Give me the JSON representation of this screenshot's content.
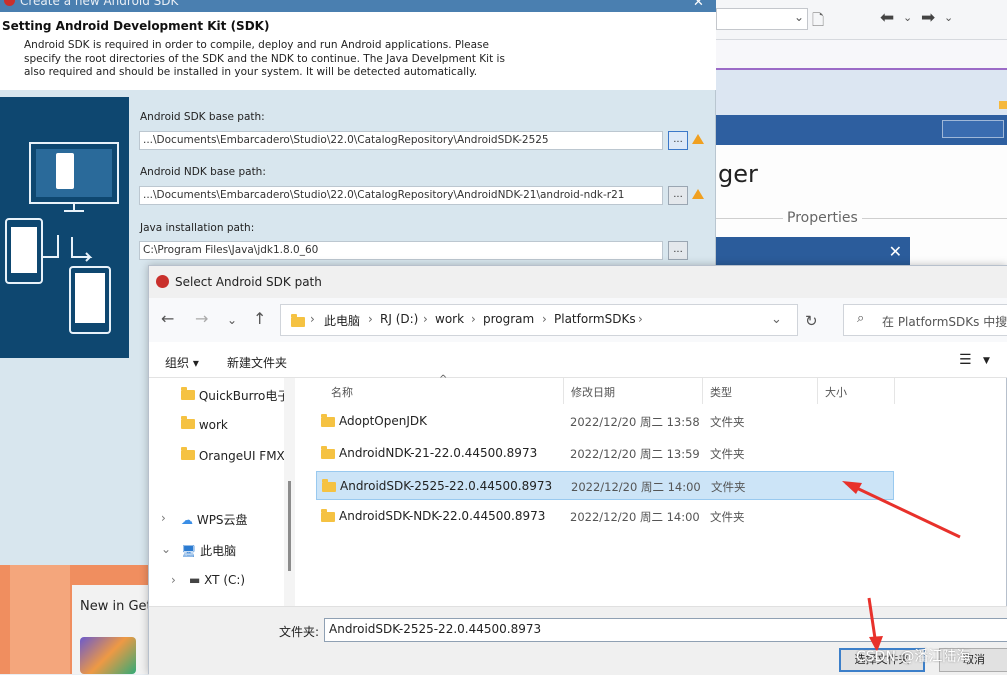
{
  "wizard": {
    "window_title": "Create a new Android SDK",
    "heading": "Setting Android Development Kit (SDK)",
    "description": "Android SDK is required in order to compile, deploy and run Android applications. Please specify the root directories of the SDK and the NDK to continue. The Java Develpment Kit is also required and should be installed in your system. It will be detected automatically.",
    "sdk_label": "Android SDK base path:",
    "sdk_value": "...\\Documents\\Embarcadero\\Studio\\22.0\\CatalogRepository\\AndroidSDK-2525",
    "ndk_label": "Android NDK base path:",
    "ndk_value": "...\\Documents\\Embarcadero\\Studio\\22.0\\CatalogRepository\\AndroidNDK-21\\android-ndk-r21",
    "java_label": "Java installation path:",
    "java_value": "C:\\Program Files\\Java\\jdk1.8.0_60",
    "browse_label": "..."
  },
  "ide": {
    "title_fragment": "ger",
    "properties_label": "Properties",
    "new_in": "New in Get"
  },
  "dialog": {
    "title": "Select Android SDK path",
    "breadcrumb": [
      "此电脑",
      "RJ (D:)",
      "work",
      "program",
      "PlatformSDKs"
    ],
    "search_placeholder": "在 PlatformSDKs 中搜索",
    "organize": "组织 ▾",
    "new_folder": "新建文件夹",
    "sidebar": [
      {
        "label": "QuickBurro电子",
        "type": "folder"
      },
      {
        "label": "work",
        "type": "folder"
      },
      {
        "label": "OrangeUI FMX",
        "type": "folder"
      },
      {
        "label": "WPS云盘",
        "type": "cloud"
      },
      {
        "label": "此电脑",
        "type": "pc"
      },
      {
        "label": "XT (C:)",
        "type": "drive"
      }
    ],
    "columns": [
      "名称",
      "修改日期",
      "类型",
      "大小"
    ],
    "rows": [
      {
        "name": "AdoptOpenJDK",
        "date": "2022/12/20 周二 13:58",
        "type": "文件夹"
      },
      {
        "name": "AndroidNDK-21-22.0.44500.8973",
        "date": "2022/12/20 周二 13:59",
        "type": "文件夹"
      },
      {
        "name": "AndroidSDK-2525-22.0.44500.8973",
        "date": "2022/12/20 周二 14:00",
        "type": "文件夹"
      },
      {
        "name": "AndroidSDK-NDK-22.0.44500.8973",
        "date": "2022/12/20 周二 14:00",
        "type": "文件夹"
      }
    ],
    "filename_label": "文件夹:",
    "filename_value": "AndroidSDK-2525-22.0.44500.8973",
    "ok_label": "选择文件夹",
    "cancel_label": "取消"
  },
  "watermark": "CSDN @潘江陆海",
  "colors": {
    "accent": "#2e5fa0",
    "selection": "#cce4f7",
    "arrow": "#e8312b",
    "warning": "#f0a020"
  }
}
